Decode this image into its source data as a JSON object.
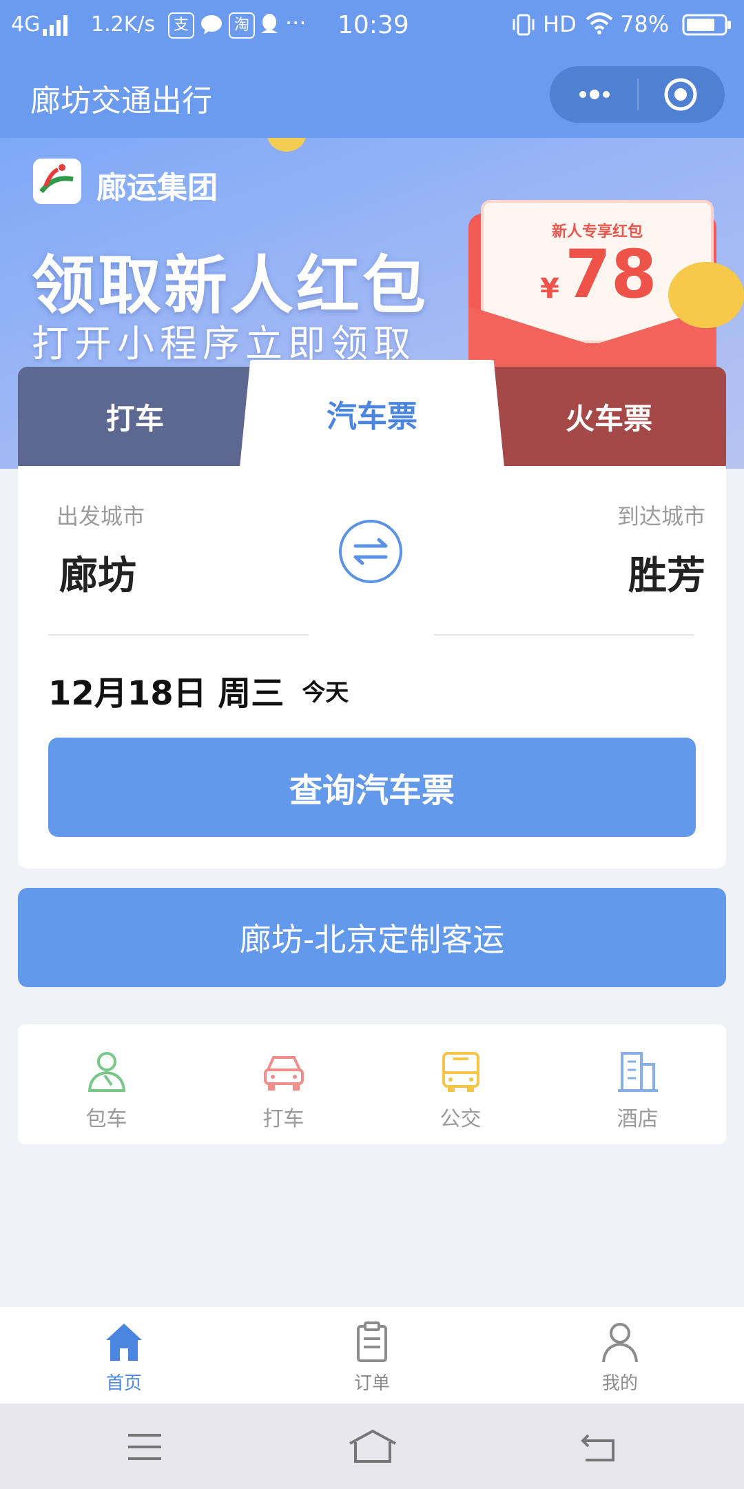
{
  "status": {
    "network": "4G",
    "speed": "1.2K/s",
    "app_icons": [
      "支",
      "淘"
    ],
    "more": "···",
    "time": "10:39",
    "hd": "HD",
    "battery": "78%"
  },
  "titlebar": {
    "title": "廊坊交通出行"
  },
  "banner": {
    "brand": "廊运集团",
    "headline": "领取新人红包",
    "subline": "打开小程序立即领取",
    "envelope_label": "新人专享红包",
    "currency": "¥",
    "amount": "78"
  },
  "tabs": [
    {
      "label": "打车"
    },
    {
      "label": "汽车票"
    },
    {
      "label": "火车票"
    }
  ],
  "search": {
    "from_label": "出发城市",
    "from_city": "廊坊",
    "to_label": "到达城市",
    "to_city": "胜芳",
    "date": "12月18日 周三",
    "today": "今天",
    "query_button": "查询汽车票"
  },
  "custom_route": {
    "label": "廊坊-北京定制客运"
  },
  "services": [
    {
      "label": "包车",
      "icon": "person-icon",
      "color": "#78c88a"
    },
    {
      "label": "打车",
      "icon": "car-icon",
      "color": "#ef8e8a"
    },
    {
      "label": "公交",
      "icon": "bus-icon",
      "color": "#f5c547"
    },
    {
      "label": "酒店",
      "icon": "building-icon",
      "color": "#86aee8"
    }
  ],
  "nav": [
    {
      "label": "首页",
      "icon": "home-icon"
    },
    {
      "label": "订单",
      "icon": "clipboard-icon"
    },
    {
      "label": "我的",
      "icon": "user-icon"
    }
  ],
  "colors": {
    "primary": "#6299ea",
    "header": "#6a9bee",
    "tab_active_text": "#4a86e0"
  }
}
